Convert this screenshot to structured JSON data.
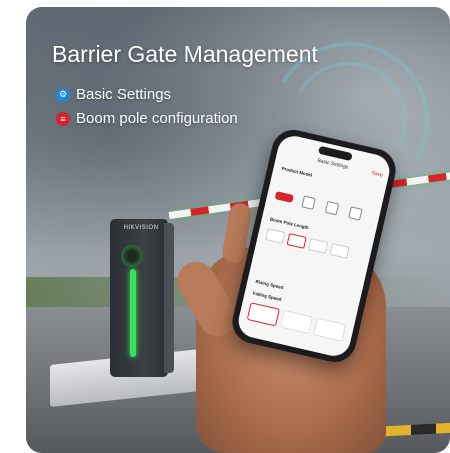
{
  "title": "Barrier Gate Management",
  "features": [
    {
      "label": "Basic Settings",
      "icon": "gear-icon",
      "color": "#1e88d8"
    },
    {
      "label": "Boom pole configuration",
      "icon": "barrier-icon",
      "color": "#d8232a"
    }
  ],
  "device": {
    "logo": "HIKVISION"
  },
  "phone_screen": {
    "header": "Basic Settings",
    "save": "Save",
    "product_model_label": "Product Model",
    "pole_length_label": "Boom Pole Length",
    "rising_speed_label": "Rising Speed",
    "falling_speed_label": "Falling Speed"
  },
  "colors": {
    "accent": "#d8232a",
    "light": "#39e25a",
    "text": "#ffffff"
  }
}
